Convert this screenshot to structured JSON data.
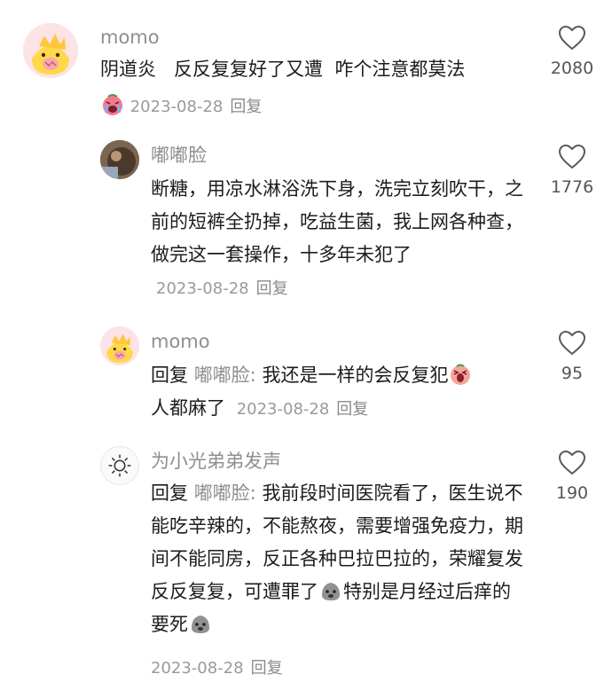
{
  "comments": [
    {
      "username": "momo",
      "text": "阴道炎   反反复复好了又遭  咋个注意都莫法",
      "date": "2023-08-28",
      "reply_label": "回复",
      "likes": "2080",
      "emoji": "crying-face-emoji"
    },
    {
      "username": "嘟嘟脸",
      "text": "断糖，用凉水淋浴洗下身，洗完立刻吹干，之前的短裤全扔掉，吃益生菌，我上网各种查，做完这一套操作，十多年未犯了",
      "date": "2023-08-28",
      "reply_label": "回复",
      "likes": "1776"
    },
    {
      "username": "momo",
      "reply_prefix": "回复",
      "reply_target": "嘟嘟脸:",
      "text_a": "我还是一样的会反复犯",
      "text_b": "人都麻了",
      "date": "2023-08-28",
      "reply_label": "回复",
      "likes": "95",
      "emoji": "screaming-peach-emoji"
    },
    {
      "username": "为小光弟弟发声",
      "reply_prefix": "回复",
      "reply_target": "嘟嘟脸:",
      "text_a": "我前段时间医院看了，医生说不能吃辛辣的，不能熬夜，需要增强免疫力，期间不能同房，反正各种巴拉巴拉的，荣耀复发反反复复，可遭罪了",
      "text_b": "特别是月经过后痒的要死",
      "date": "2023-08-28",
      "reply_label": "回复",
      "likes": "190",
      "emoji": "rock-face-emoji"
    }
  ],
  "colors": {
    "username": "#8f8f8f",
    "text": "#1c1c1c",
    "meta": "#9a9a9a"
  }
}
